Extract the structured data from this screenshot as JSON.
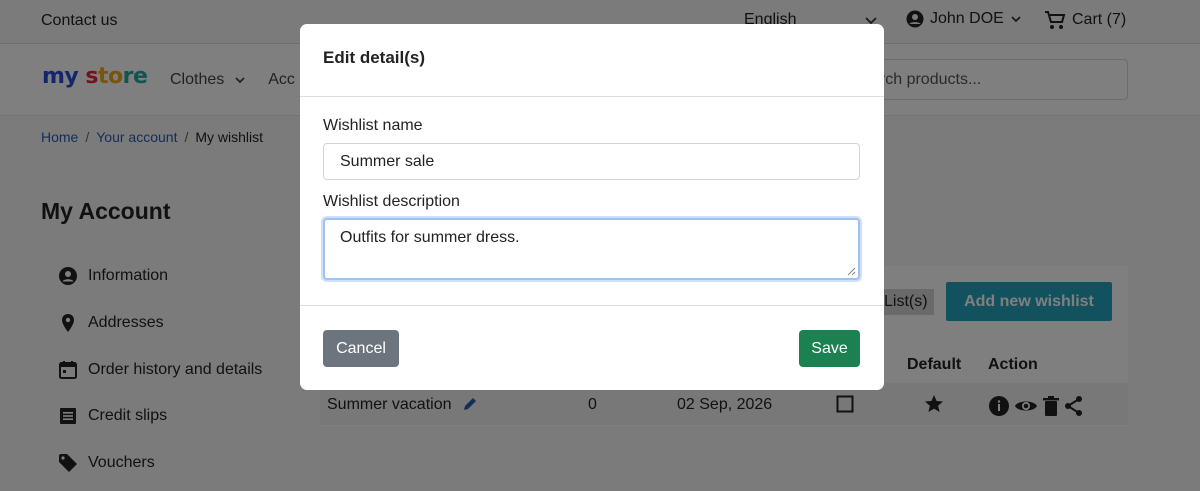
{
  "topbar": {
    "contact": "Contact us",
    "language": "English",
    "user": "John DOE",
    "cart": "Cart (7)"
  },
  "header": {
    "logo": {
      "part1": "my",
      "part2": " s",
      "part3": "to",
      "part4": "re"
    },
    "nav": [
      "Clothes",
      "Acc"
    ],
    "search_placeholder": "arch products..."
  },
  "breadcrumb": [
    "Home",
    "Your account",
    "My wishlist"
  ],
  "account": {
    "title": "My Account",
    "menu": [
      "Information",
      "Addresses",
      "Order history and details",
      "Credit slips",
      "Vouchers"
    ]
  },
  "wishlist": {
    "lists_tag": "List(s)",
    "add_button": "Add new wishlist",
    "columns": {
      "default": "Default",
      "action": "Action"
    },
    "row": {
      "name": "Summer vacation",
      "count": "0",
      "date": "02 Sep, 2026"
    }
  },
  "modal": {
    "title": "Edit detail(s)",
    "name_label": "Wishlist name",
    "name_value": "Summer sale",
    "desc_label": "Wishlist description",
    "desc_value": "Outfits for summer dress.",
    "cancel": "Cancel",
    "save": "Save"
  },
  "colors": {
    "add_button": "#25a5bf",
    "save_button": "#1b8150",
    "cancel_button": "#6c757d",
    "link": "#2a5db0"
  }
}
